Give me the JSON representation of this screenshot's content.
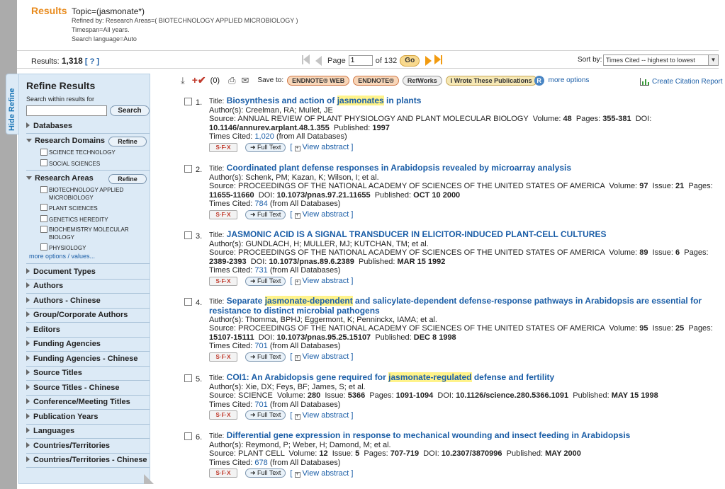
{
  "header": {
    "results_label": "Results",
    "topic": "Topic=(jasmonate*)",
    "refined_by": "Refined by: Research Areas=( BIOTECHNOLOGY APPLIED MICROBIOLOGY )",
    "timespan": "Timespan=All years.",
    "search_language": "Search language=Auto"
  },
  "results_bar": {
    "results_prefix": "Results:",
    "results_count": "1,318",
    "help_link": "[ ? ]",
    "page_label": "Page",
    "page_value": "1",
    "of_label": "of 132",
    "go_label": "Go",
    "sort_label": "Sort by:",
    "sort_value": "Times Cited -- highest to lowest"
  },
  "sidebar": {
    "hide_tab": "Hide Refine",
    "title": "Refine Results",
    "search_within_label": "Search within results for",
    "search_button": "Search",
    "databases": "Databases",
    "research_domains": "Research Domains",
    "refine_button": "Refine",
    "domains": [
      "SCIENCE TECHNOLOGY",
      "SOCIAL SCIENCES"
    ],
    "research_areas": "Research Areas",
    "areas": [
      "BIOTECHNOLOGY APPLIED MICROBIOLOGY",
      "PLANT SCIENCES",
      "GENETICS HEREDITY",
      "BIOCHEMISTRY MOLECULAR BIOLOGY",
      "PHYSIOLOGY"
    ],
    "more_options": "more options / values...",
    "sections": [
      "Document Types",
      "Authors",
      "Authors - Chinese",
      "Group/Corporate Authors",
      "Editors",
      "Funding Agencies",
      "Funding Agencies - Chinese",
      "Source Titles",
      "Source Titles - Chinese",
      "Conference/Meeting Titles",
      "Publication Years",
      "Languages",
      "Countries/Territories",
      "Countries/Territories - Chinese"
    ]
  },
  "toolbar": {
    "marked_count": "(0)",
    "save_to": "Save to:",
    "endnote_web": "ENDNOTE® WEB",
    "endnote": "ENDNOTE®",
    "refworks": "RefWorks",
    "i_wrote": "I Wrote These Publications",
    "r_badge": "R",
    "more_options": "more options",
    "citation_report": "Create Citation Report"
  },
  "labels": {
    "title": "Title:",
    "authors": "Author(s):",
    "source": "Source:",
    "volume": "Volume:",
    "issue": "Issue:",
    "pages": "Pages:",
    "doi": "DOI:",
    "published": "Published:",
    "times_cited": "Times Cited:",
    "from_db": "(from All Databases)",
    "sfx": "S·F·X",
    "full_text": "Full Text",
    "view_abstract": "View abstract"
  },
  "records": [
    {
      "num": "1.",
      "t1": "Biosynthesis and action of ",
      "hl": "jasmonates",
      "t2": " in plants",
      "authors": "Creelman, RA; Mullet, JE",
      "source": "ANNUAL REVIEW OF PLANT PHYSIOLOGY AND PLANT MOLECULAR BIOLOGY",
      "volume": "48",
      "issue": "",
      "pages": "355-381",
      "doi": "10.1146/annurev.arplant.48.1.355",
      "published": "1997",
      "cited": "1,020"
    },
    {
      "num": "2.",
      "t1": "Coordinated plant defense responses in Arabidopsis revealed by microarray analysis",
      "hl": "",
      "t2": "",
      "authors": "Schenk, PM; Kazan, K; Wilson, I; et al.",
      "source": "PROCEEDINGS OF THE NATIONAL ACADEMY OF SCIENCES OF THE UNITED STATES OF AMERICA",
      "volume": "97",
      "issue": "21",
      "pages": "11655-11660",
      "doi": "10.1073/pnas.97.21.11655",
      "published": "OCT 10 2000",
      "cited": "784"
    },
    {
      "num": "3.",
      "t1": "JASMONIC ACID IS A SIGNAL TRANSDUCER IN ELICITOR-INDUCED PLANT-CELL CULTURES",
      "hl": "",
      "t2": "",
      "authors": "GUNDLACH, H; MULLER, MJ; KUTCHAN, TM; et al.",
      "source": "PROCEEDINGS OF THE NATIONAL ACADEMY OF SCIENCES OF THE UNITED STATES OF AMERICA",
      "volume": "89",
      "issue": "6",
      "pages": "2389-2393",
      "doi": "10.1073/pnas.89.6.2389",
      "published": "MAR 15 1992",
      "cited": "731"
    },
    {
      "num": "4.",
      "t1": "Separate ",
      "hl": "jasmonate-dependent",
      "t2": " and salicylate-dependent defense-response pathways in Arabidopsis are essential for resistance to distinct microbial pathogens",
      "authors": "Thomma, BPHJ; Eggermont, K; Penninckx, IAMA; et al.",
      "source": "PROCEEDINGS OF THE NATIONAL ACADEMY OF SCIENCES OF THE UNITED STATES OF AMERICA",
      "volume": "95",
      "issue": "25",
      "pages": "15107-15111",
      "doi": "10.1073/pnas.95.25.15107",
      "published": "DEC 8 1998",
      "cited": "701"
    },
    {
      "num": "5.",
      "t1": "COI1: An Arabidopsis gene required for ",
      "hl": "jasmonate-regulated",
      "t2": " defense and fertility",
      "authors": "Xie, DX; Feys, BF; James, S; et al.",
      "source": "SCIENCE",
      "volume": "280",
      "issue": "5366",
      "pages": "1091-1094",
      "doi": "10.1126/science.280.5366.1091",
      "published": "MAY 15 1998",
      "cited": "701"
    },
    {
      "num": "6.",
      "t1": "Differential gene expression in response to mechanical wounding and insect feeding in Arabidopsis",
      "hl": "",
      "t2": "",
      "authors": "Reymond, P; Weber, H; Damond, M; et al.",
      "source": "PLANT CELL",
      "volume": "12",
      "issue": "5",
      "pages": "707-719",
      "doi": "10.2307/3870996",
      "published": "MAY 2000",
      "cited": "678"
    }
  ]
}
